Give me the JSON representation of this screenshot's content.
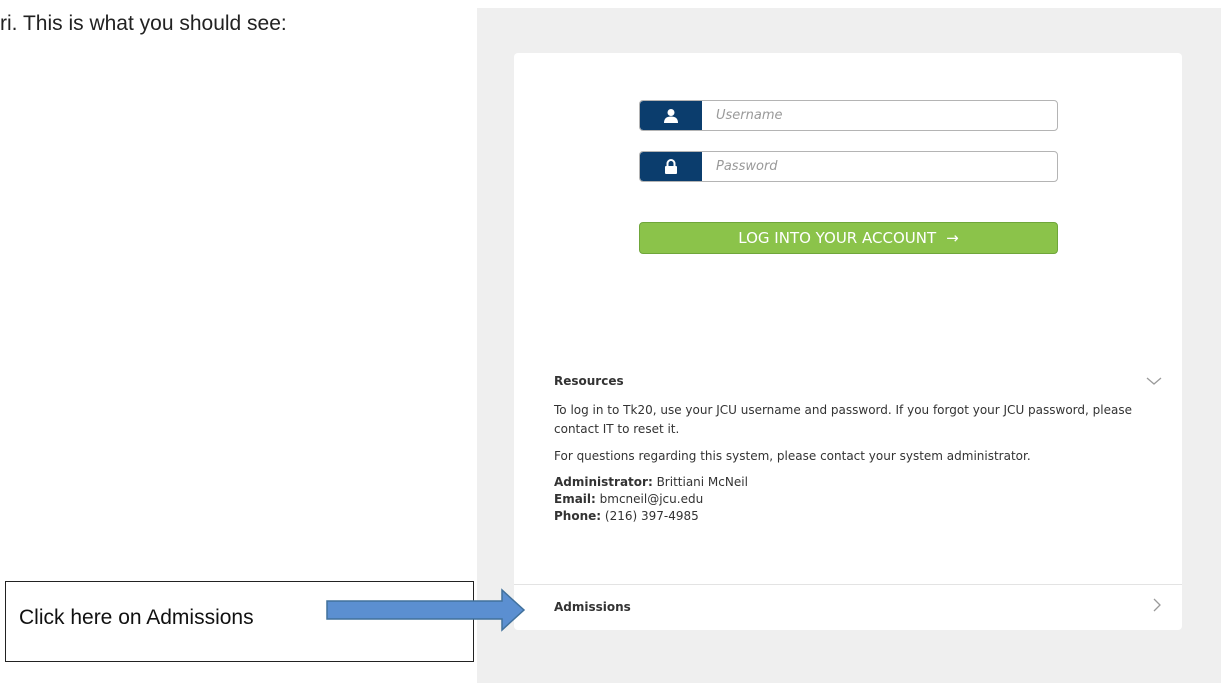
{
  "document": {
    "intro_text": "ri. This is what you should see:",
    "callout_text": "Click here on Admissions"
  },
  "login": {
    "username_placeholder": "Username",
    "password_placeholder": "Password",
    "login_button": "LOG INTO YOUR ACCOUNT",
    "login_arrow": "→"
  },
  "resources": {
    "title": "Resources",
    "paragraph1": "To log in to Tk20, use your JCU username and password. If you forgot your JCU password, please contact IT to reset it.",
    "paragraph2": "For questions regarding this system, please contact your system administrator.",
    "admin_label": "Administrator:",
    "admin_value": "Brittiani McNeil",
    "email_label": "Email:",
    "email_value": "bmcneil@jcu.edu",
    "phone_label": "Phone:",
    "phone_value": "(216) 397-4985"
  },
  "admissions": {
    "title": "Admissions"
  },
  "colors": {
    "addon_blue": "#0b3d6d",
    "login_green": "#8bc34a",
    "callout_arrow": "#5b8fd1"
  },
  "icons": {
    "username_addon": "user-icon",
    "password_addon": "lock-icon",
    "resources_toggle": "chevron-down-icon",
    "admissions_toggle": "chevron-right-icon",
    "callout_pointer": "arrow-right-icon"
  }
}
